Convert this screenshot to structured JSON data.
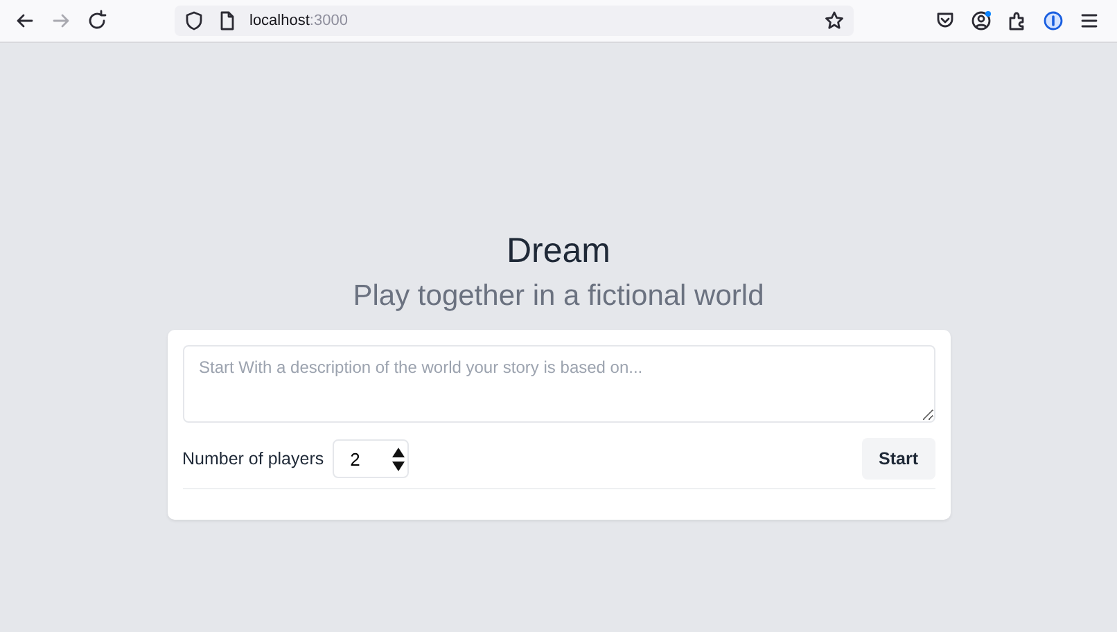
{
  "browser": {
    "url_host": "localhost",
    "url_port": ":3000",
    "forward_disabled": true
  },
  "page": {
    "title": "Dream",
    "subtitle": "Play together in a fictional world",
    "prompt": {
      "placeholder": "Start With a description of the world your story is based on..."
    },
    "players": {
      "label": "Number of players",
      "value": "2"
    },
    "start_button": "Start"
  }
}
